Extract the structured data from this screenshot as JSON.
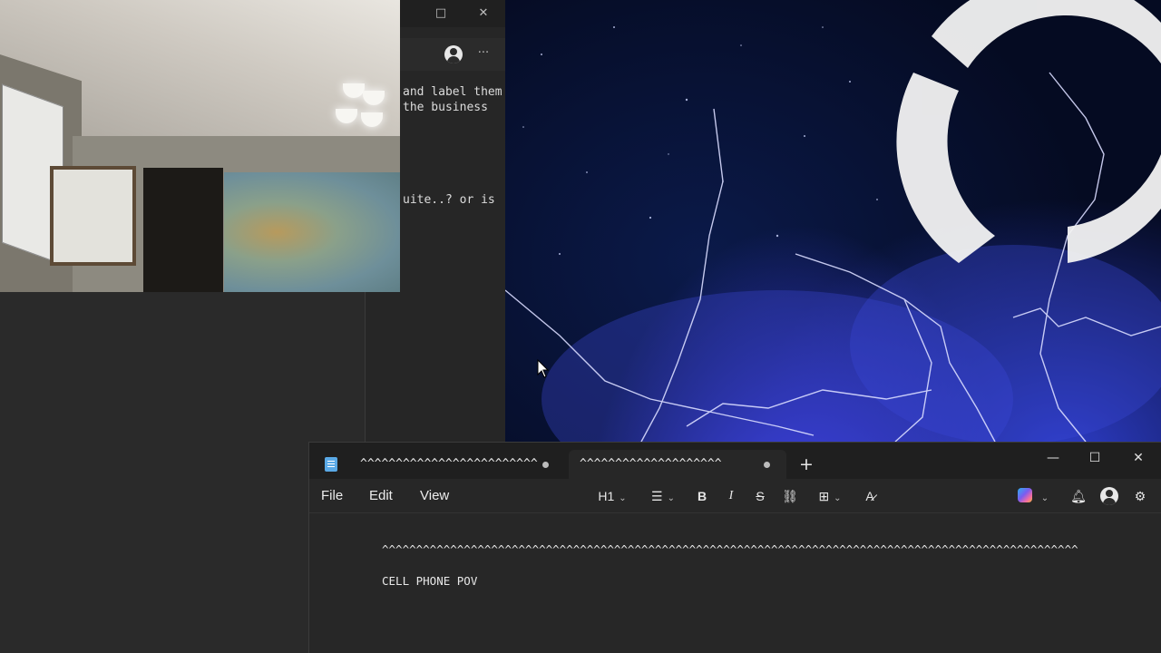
{
  "behind_window": {
    "lines": [
      "and label them",
      "the business",
      "uite..? or is"
    ],
    "controls": {
      "maximize": "□",
      "close": "✕",
      "more": "···"
    }
  },
  "notepad": {
    "tabs": [
      {
        "label": "^^^^^^^^^^^^^^^^^^^^^^^^^^^^^^^^",
        "modified": true,
        "active": false
      },
      {
        "label": "^^^^^^^^^^^^^^^^^^^^",
        "modified": true,
        "active": true
      }
    ],
    "new_tab_label": "+",
    "window_controls": {
      "minimize": "—",
      "maximize": "☐",
      "close": "✕"
    },
    "menu": {
      "file": "File",
      "edit": "Edit",
      "view": "View"
    },
    "toolbar": {
      "heading": "H1",
      "list_icon": "☰",
      "bold": "B",
      "italic": "I",
      "strikethrough": "S",
      "link_icon": "⛓",
      "table_icon": "⊞",
      "clear_format_icon": "A̷"
    },
    "content": {
      "line1": "^^^^^^^^^^^^^^^^^^^^^^^^^^^^^^^^^^^^^^^^^^^^^^^^^^^^^^^^^^^^^^^^^^^^^^^^^^^^^^^^^^^^^^^^^^^^^^^^^^^^^^",
      "line2": "CELL PHONE POV"
    }
  },
  "colors": {
    "notepad_bg": "#272727",
    "tabbar_bg": "#1f1f1f",
    "accent_blue": "#5aa9e6"
  }
}
